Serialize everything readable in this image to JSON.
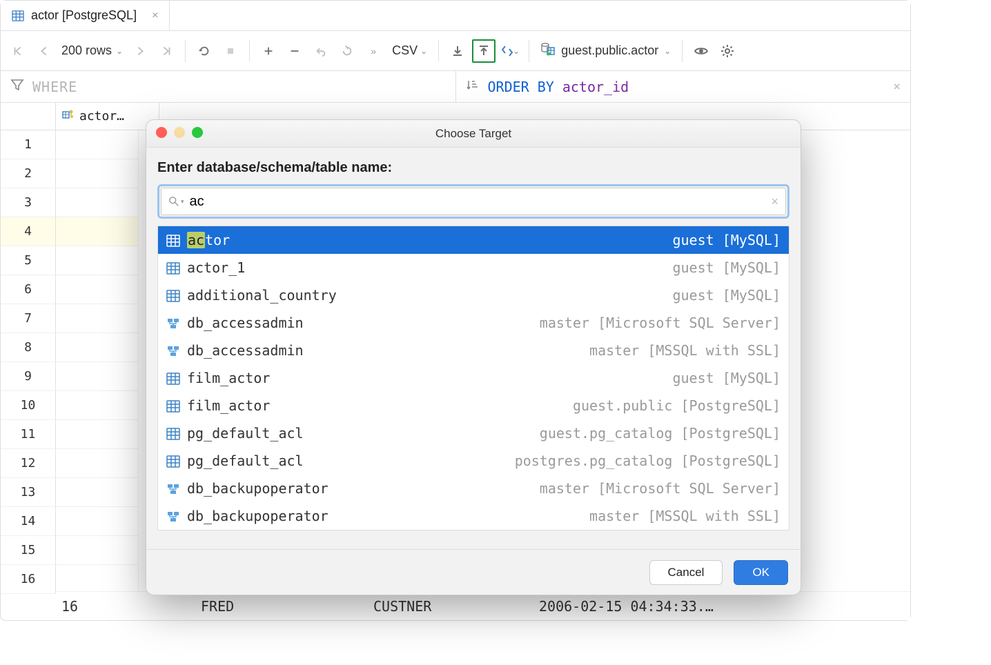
{
  "tab": {
    "title": "actor [PostgreSQL]"
  },
  "toolbar": {
    "rows_label": "200 rows",
    "csv_label": "CSV",
    "schema_path": "guest.public.actor"
  },
  "filter": {
    "where_placeholder": "WHERE",
    "order_by_kw": "ORDER BY",
    "order_by_col": "actor_id"
  },
  "grid": {
    "column_header": "actor…",
    "row_numbers": [
      1,
      2,
      3,
      4,
      5,
      6,
      7,
      8,
      9,
      10,
      11,
      12,
      13,
      14,
      15,
      16
    ],
    "selected_row_index": 3,
    "peek_row": {
      "id": "16",
      "first": "FRED",
      "last": "CUSTNER",
      "upd": "2006-02-15 04:34:33.…"
    }
  },
  "modal": {
    "title": "Choose Target",
    "prompt": "Enter database/schema/table name:",
    "search_value": "ac",
    "cancel_label": "Cancel",
    "ok_label": "OK",
    "results": [
      {
        "icon": "table",
        "name": "actor",
        "match_prefix": "ac",
        "match_rest": "tor",
        "ctx": "guest [MySQL]",
        "selected": true
      },
      {
        "icon": "table",
        "name": "actor_1",
        "ctx": "guest [MySQL]"
      },
      {
        "icon": "table",
        "name": "additional_country",
        "ctx": "guest [MySQL]"
      },
      {
        "icon": "schema",
        "name": "db_accessadmin",
        "ctx": "master [Microsoft SQL Server]"
      },
      {
        "icon": "schema",
        "name": "db_accessadmin",
        "ctx": "master [MSSQL with SSL]"
      },
      {
        "icon": "table",
        "name": "film_actor",
        "ctx": "guest [MySQL]"
      },
      {
        "icon": "table",
        "name": "film_actor",
        "ctx": "guest.public [PostgreSQL]"
      },
      {
        "icon": "table",
        "name": "pg_default_acl",
        "ctx": "guest.pg_catalog [PostgreSQL]"
      },
      {
        "icon": "table",
        "name": "pg_default_acl",
        "ctx": "postgres.pg_catalog [PostgreSQL]"
      },
      {
        "icon": "schema",
        "name": "db_backupoperator",
        "ctx": "master [Microsoft SQL Server]"
      },
      {
        "icon": "schema",
        "name": "db_backupoperator",
        "ctx": "master [MSSQL with SSL]"
      }
    ]
  }
}
